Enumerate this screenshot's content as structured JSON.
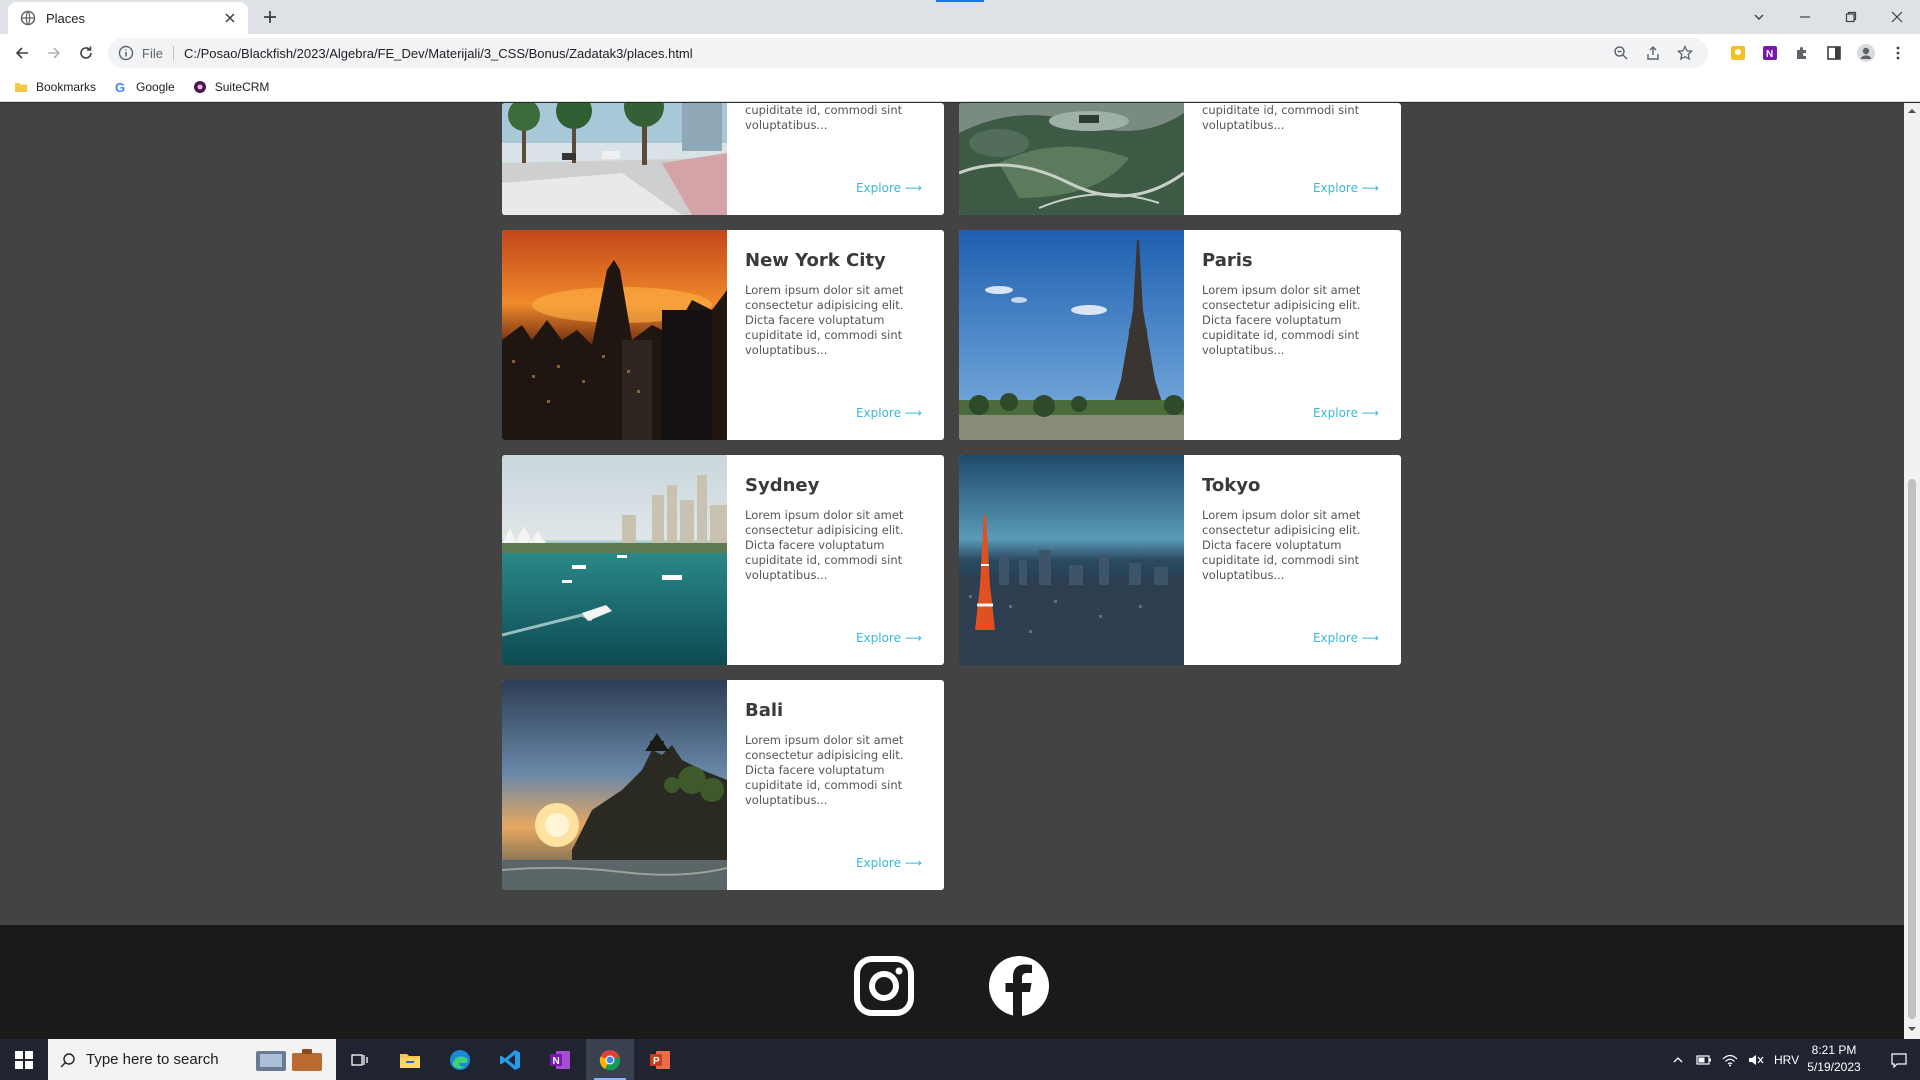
{
  "browser": {
    "tab_title": "Places",
    "file_label": "File",
    "url": "C:/Posao/Blackfish/2023/Algebra/FE_Dev/Materijali/3_CSS/Bonus/Zadatak3/places.html",
    "bookmarks": [
      {
        "label": "Bookmarks",
        "icon": "folder-icon"
      },
      {
        "label": "Google",
        "icon": "google-icon"
      },
      {
        "label": "SuiteCRM",
        "icon": "suitecrm-icon"
      }
    ]
  },
  "cards": [
    {
      "name": "",
      "desc": "cupiditate id, commodi sint voluptatibus...",
      "explore": "Explore ⟶"
    },
    {
      "name": "",
      "desc": "cupiditate id, commodi sint voluptatibus...",
      "explore": "Explore ⟶"
    },
    {
      "name": "New York City",
      "desc": "Lorem ipsum dolor sit amet consectetur adipisicing elit. Dicta facere voluptatum cupiditate id, commodi sint voluptatibus...",
      "explore": "Explore ⟶"
    },
    {
      "name": "Paris",
      "desc": "Lorem ipsum dolor sit amet consectetur adipisicing elit. Dicta facere voluptatum cupiditate id, commodi sint voluptatibus...",
      "explore": "Explore ⟶"
    },
    {
      "name": "Sydney",
      "desc": "Lorem ipsum dolor sit amet consectetur adipisicing elit. Dicta facere voluptatum cupiditate id, commodi sint voluptatibus...",
      "explore": "Explore ⟶"
    },
    {
      "name": "Tokyo",
      "desc": "Lorem ipsum dolor sit amet consectetur adipisicing elit. Dicta facere voluptatum cupiditate id, commodi sint voluptatibus...",
      "explore": "Explore ⟶"
    },
    {
      "name": "Bali",
      "desc": "Lorem ipsum dolor sit amet consectetur adipisicing elit. Dicta facere voluptatum cupiditate id, commodi sint voluptatibus...",
      "explore": "Explore ⟶"
    }
  ],
  "footer": {
    "icons": [
      "instagram-icon",
      "facebook-icon"
    ]
  },
  "taskbar": {
    "search_placeholder": "Type here to search",
    "language": "HRV",
    "time": "8:21 PM",
    "date": "5/19/2023"
  },
  "colors": {
    "page_bg": "#434343",
    "footer_bg": "#1a1a1a",
    "link": "#3bb8d6",
    "taskbar": "#1f2430"
  }
}
